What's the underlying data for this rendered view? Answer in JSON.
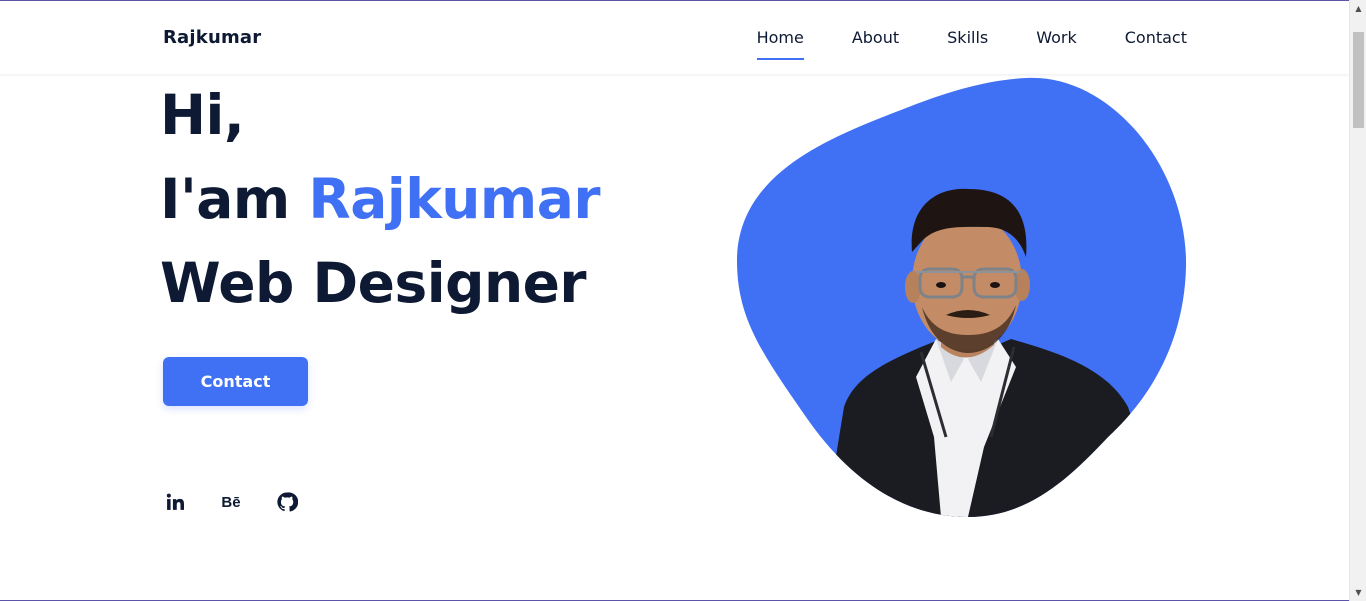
{
  "header": {
    "logo": "Rajkumar",
    "nav": [
      {
        "label": "Home",
        "active": true
      },
      {
        "label": "About",
        "active": false
      },
      {
        "label": "Skills",
        "active": false
      },
      {
        "label": "Work",
        "active": false
      },
      {
        "label": "Contact",
        "active": false
      }
    ]
  },
  "hero": {
    "greeting": "Hi,",
    "intro_prefix": "I'am ",
    "name": "Rajkumar",
    "role": "Web Designer",
    "contact_button": "Contact"
  },
  "socials": [
    {
      "icon": "linkedin-icon"
    },
    {
      "icon": "behance-icon",
      "text": "Bē"
    },
    {
      "icon": "github-icon"
    }
  ],
  "colors": {
    "accent": "#4070f4",
    "text": "#0e1a33",
    "background": "#ffffff"
  }
}
